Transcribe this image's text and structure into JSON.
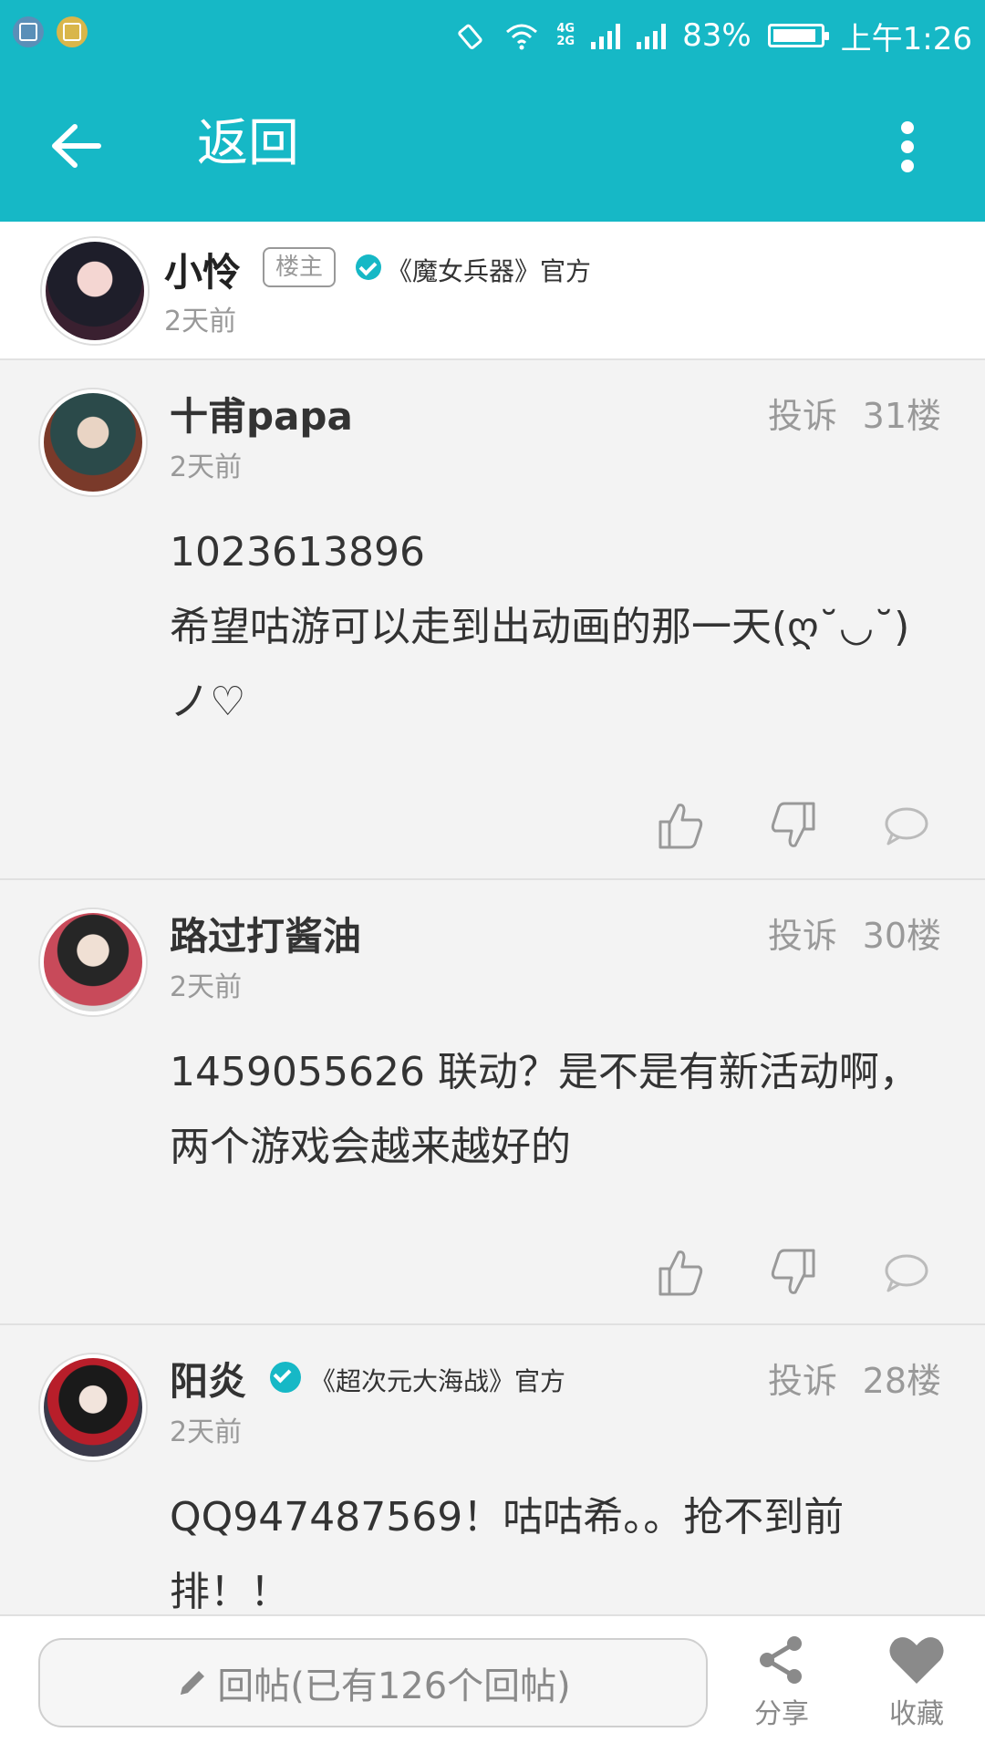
{
  "status_bar": {
    "network_4g": "4G",
    "network_2g": "2G",
    "battery_percent": "83%",
    "time": "上午1:26"
  },
  "app_bar": {
    "title": "返回"
  },
  "thread_author": {
    "name": "小怜",
    "op_badge": "楼主",
    "official": "《魔女兵器》官方",
    "time": "2天前"
  },
  "posts": [
    {
      "username": "十甫papa",
      "report": "投诉",
      "floor": "31楼",
      "time": "2天前",
      "content": "1023613896\n希望咕游可以走到出动画的那一天(ღ˘◡˘)ノ♡"
    },
    {
      "username": "路过打酱油",
      "report": "投诉",
      "floor": "30楼",
      "time": "2天前",
      "content": "1459055626  联动？是不是有新活动啊，两个游戏会越来越好的"
    },
    {
      "username": "阳炎",
      "official": "《超次元大海战》官方",
      "report": "投诉",
      "floor": "28楼",
      "time": "2天前",
      "content": "QQ947487569！咕咕希。。抢不到前排！！"
    }
  ],
  "bottom_bar": {
    "reply_placeholder": "回帖(已有126个回帖)",
    "share_label": "分享",
    "favorite_label": "收藏"
  },
  "colors": {
    "accent": "#16b8c6",
    "text_primary": "#333333",
    "text_secondary": "#999999"
  }
}
